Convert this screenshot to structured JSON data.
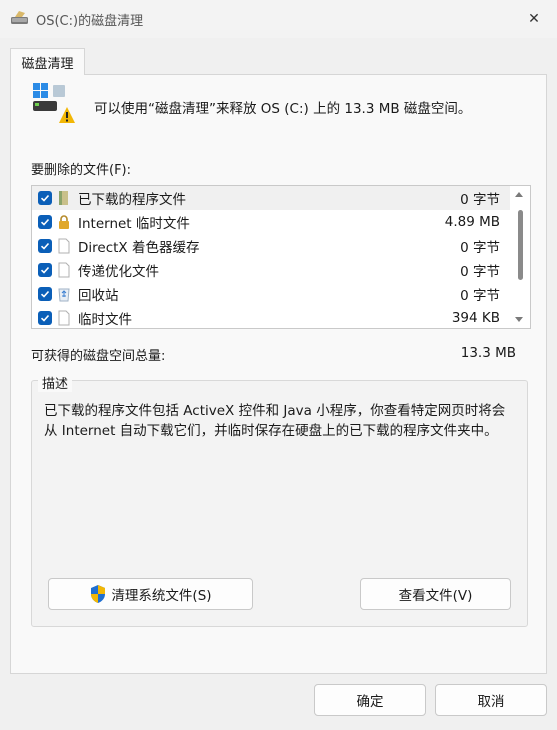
{
  "window": {
    "title": "OS(C:)的磁盘清理",
    "close_glyph": "✕"
  },
  "tab": {
    "label": "磁盘清理"
  },
  "summary": {
    "text": "可以使用“磁盘清理”来释放 OS (C:) 上的 13.3 MB 磁盘空间。"
  },
  "files": {
    "label": "要删除的文件(F):",
    "items": [
      {
        "name": "已下载的程序文件",
        "size": "0 字节",
        "checked": true,
        "icon": "folder-icon"
      },
      {
        "name": "Internet 临时文件",
        "size": "4.89 MB",
        "checked": true,
        "icon": "lock-icon"
      },
      {
        "name": "DirectX 着色器缓存",
        "size": "0 字节",
        "checked": true,
        "icon": "file-icon"
      },
      {
        "name": "传递优化文件",
        "size": "0 字节",
        "checked": true,
        "icon": "file-icon"
      },
      {
        "name": "回收站",
        "size": "0 字节",
        "checked": true,
        "icon": "recycle-bin-icon"
      },
      {
        "name": "临时文件",
        "size": "394 KB",
        "checked": true,
        "icon": "file-icon"
      }
    ]
  },
  "total": {
    "label": "可获得的磁盘空间总量:",
    "value": "13.3 MB"
  },
  "description": {
    "legend": "描述",
    "text": "已下载的程序文件包括 ActiveX 控件和 Java 小程序，你查看特定网页时将会从 Internet 自动下载它们，并临时保存在硬盘上的已下载的程序文件夹中。"
  },
  "buttons": {
    "clean_system": "清理系统文件(S)",
    "view_files": "查看文件(V)",
    "ok": "确定",
    "cancel": "取消"
  },
  "colors": {
    "checkbox": "#0b5fb8",
    "shield_blue": "#1f6fd1",
    "shield_yellow": "#f2b705"
  }
}
